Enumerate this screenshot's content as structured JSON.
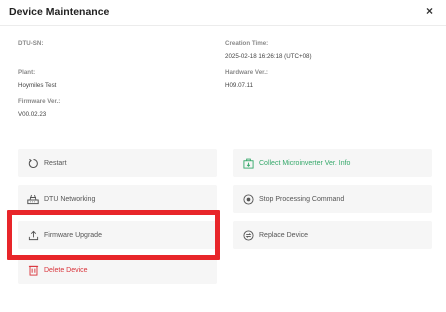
{
  "dialog": {
    "title": "Device Maintenance",
    "close": "×"
  },
  "info": {
    "dtu_sn": {
      "label": "DTU-SN:",
      "value": ""
    },
    "creation_time": {
      "label": "Creation Time:",
      "value": "2025-02-18 16:26:18 (UTC+08)"
    },
    "plant": {
      "label": "Plant:",
      "value": "Hoymiles Test"
    },
    "hardware_ver": {
      "label": "Hardware Ver.:",
      "value": "H09.07.11"
    },
    "firmware_ver": {
      "label": "Firmware Ver.:",
      "value": "V00.02.23"
    }
  },
  "actions": {
    "restart": "Restart",
    "collect": "Collect Microinverter Ver. Info",
    "dtu_networking": "DTU Networking",
    "stop_processing": "Stop Processing Command",
    "firmware_upgrade": "Firmware Upgrade",
    "replace_device": "Replace Device",
    "delete_device": "Delete Device"
  },
  "colors": {
    "accent_green": "#35a86a",
    "danger_red": "#d9333a",
    "highlight_red": "#e8262a",
    "button_bg": "#f6f6f6"
  }
}
